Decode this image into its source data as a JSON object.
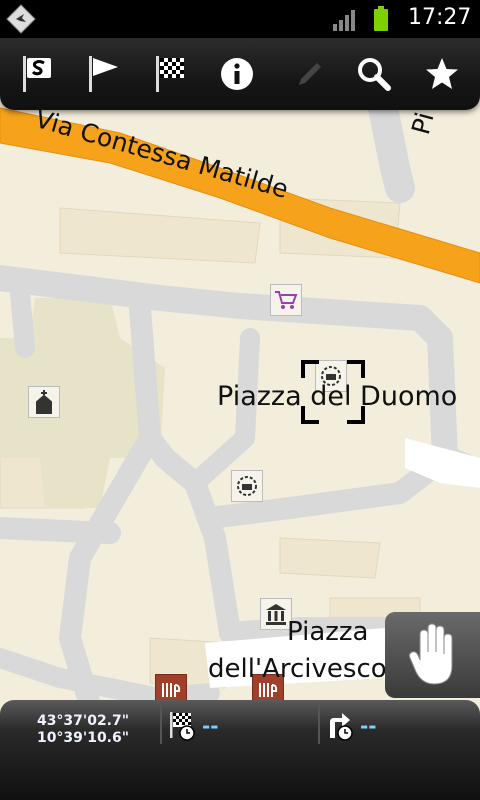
{
  "status_bar": {
    "time": "17:27",
    "icons": [
      "app-notification-icon",
      "signal-icon",
      "battery-icon"
    ]
  },
  "toolbar": {
    "buttons": [
      {
        "name": "set-start-button",
        "icon": "start-flag-icon"
      },
      {
        "name": "set-waypoint-button",
        "icon": "waypoint-flag-icon"
      },
      {
        "name": "set-destination-button",
        "icon": "checkered-flag-icon"
      },
      {
        "name": "info-button",
        "icon": "info-icon"
      },
      {
        "name": "edit-button",
        "icon": "pencil-icon",
        "disabled": true
      },
      {
        "name": "search-button",
        "icon": "search-icon"
      },
      {
        "name": "favorites-button",
        "icon": "star-icon"
      }
    ]
  },
  "map": {
    "streets": [
      "Via Contessa Matilde",
      "Pi"
    ],
    "places": [
      "Piazza del Duomo",
      "Piazza",
      "dell'Arcivesco"
    ],
    "pois": [
      "shopping-cart-icon",
      "church-icon",
      "monument-icon",
      "monument-icon",
      "museum-icon",
      "restaurant-icon",
      "restaurant-icon"
    ],
    "colors": {
      "land": "#f3eddc",
      "road": "#dcdcdc",
      "main_road": "#f7a21b",
      "park": "#e4e2c6"
    }
  },
  "bottom_bar": {
    "latitude": "43°37'02.7\"",
    "longitude": "10°39'10.6\"",
    "distance_to_destination": "--",
    "distance_to_next_turn": "--"
  }
}
